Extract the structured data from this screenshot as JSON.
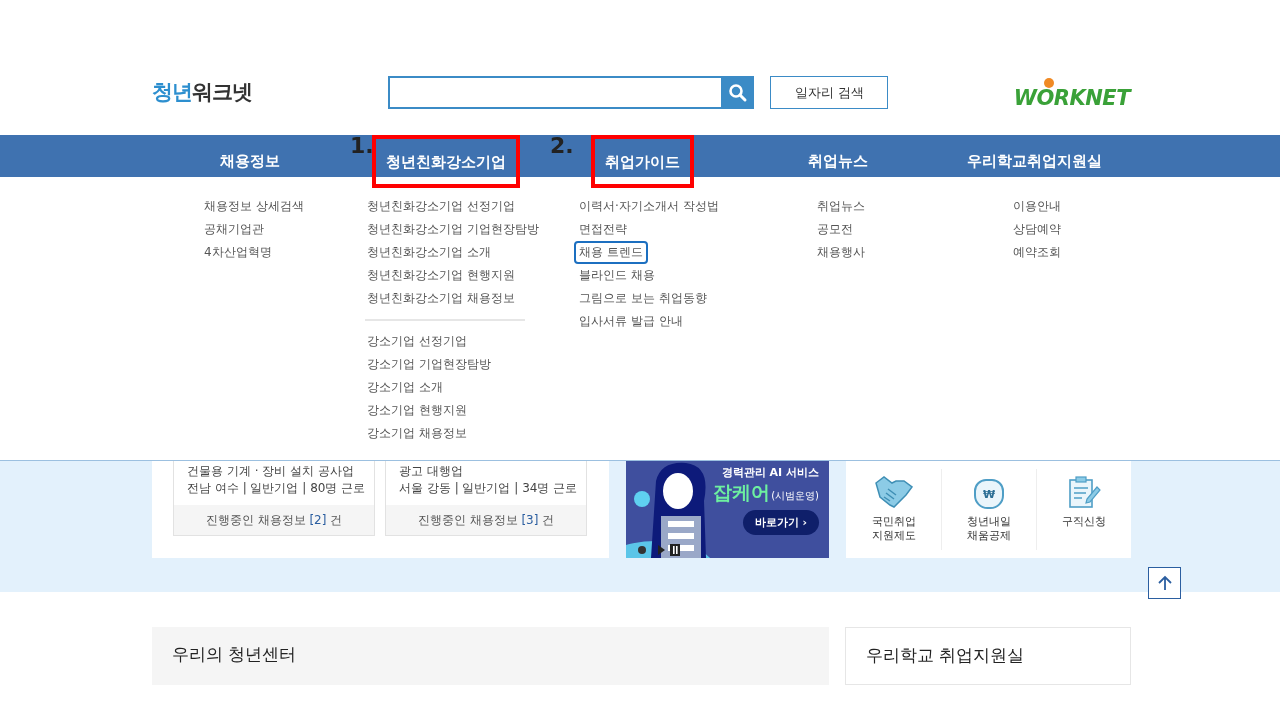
{
  "header": {
    "logo": {
      "accent": "청년",
      "rest": "워크넷"
    },
    "job_search_button": "일자리 검색",
    "partner_logo": "WORKNET"
  },
  "nav": [
    {
      "label": "채용정보",
      "highlighted": false
    },
    {
      "label": "청년친화강소기업",
      "marker": "1.",
      "highlighted": true
    },
    {
      "label": "취업가이드",
      "marker": "2.",
      "highlighted": true
    },
    {
      "label": "취업뉴스",
      "highlighted": false
    },
    {
      "label": "우리학교취업지원실",
      "highlighted": false
    }
  ],
  "dropdown": [
    {
      "groups": [
        [
          {
            "label": "채용정보 상세검색",
            "highlighted": false
          },
          {
            "label": "공채기업관",
            "highlighted": false
          },
          {
            "label": "4차산업혁명",
            "highlighted": false
          }
        ]
      ]
    },
    {
      "groups": [
        [
          {
            "label": "청년친화강소기업 선정기업",
            "highlighted": false
          },
          {
            "label": "청년친화강소기업 기업현장탐방",
            "highlighted": false
          },
          {
            "label": "청년친화강소기업 소개",
            "highlighted": false
          },
          {
            "label": "청년친화강소기업 현행지원",
            "highlighted": false
          },
          {
            "label": "청년친화강소기업 채용정보",
            "highlighted": false
          }
        ],
        [
          {
            "label": "강소기업 선정기업",
            "highlighted": false
          },
          {
            "label": "강소기업 기업현장탐방",
            "highlighted": false
          },
          {
            "label": "강소기업 소개",
            "highlighted": false
          },
          {
            "label": "강소기업 현행지원",
            "highlighted": false
          },
          {
            "label": "강소기업 채용정보",
            "highlighted": false
          }
        ]
      ]
    },
    {
      "groups": [
        [
          {
            "label": "이력서·자기소개서 작성법",
            "highlighted": false
          },
          {
            "label": "면접전략",
            "highlighted": false
          },
          {
            "label": "채용 트렌드",
            "highlighted": true
          },
          {
            "label": "블라인드 채용",
            "highlighted": false
          },
          {
            "label": "그림으로 보는 취업동향",
            "highlighted": false
          },
          {
            "label": "입사서류 발급 안내",
            "highlighted": false
          }
        ]
      ]
    },
    {
      "groups": [
        [
          {
            "label": "취업뉴스",
            "highlighted": false
          },
          {
            "label": "공모전",
            "highlighted": false
          },
          {
            "label": "채용행사",
            "highlighted": false
          }
        ]
      ]
    },
    {
      "groups": [
        [
          {
            "label": "이용안내",
            "highlighted": false
          },
          {
            "label": "상담예약",
            "highlighted": false
          },
          {
            "label": "예약조회",
            "highlighted": false
          }
        ]
      ]
    }
  ],
  "job_cards": [
    {
      "industry": "건물용 기계 · 장비 설치 공사업",
      "details": "전남 여수 | 일반기업 | 80명 근로",
      "footer_prefix": "진행중인 채용정보 ",
      "count": "[2]",
      "footer_suffix": " 건"
    },
    {
      "industry": "광고 대행업",
      "details": "서울 강동 | 일반기업 | 34명 근로",
      "footer_prefix": "진행중인 채용정보 ",
      "count": "[3]",
      "footer_suffix": " 건"
    }
  ],
  "banner": {
    "kind": "picture",
    "subtitle": "경력관리 AI 서비스",
    "title": "잡케어",
    "note": "(시범운영)",
    "button": "바로가기 ›"
  },
  "quick_links": [
    {
      "kind": "handshake",
      "lines": [
        "국민취업",
        "지원제도"
      ]
    },
    {
      "kind": "moneybag",
      "symbol": "₩",
      "lines": [
        "청년내일",
        "채움공제"
      ]
    },
    {
      "kind": "clipboard",
      "lines": [
        "구직신청"
      ]
    }
  ],
  "bottom_panels": [
    {
      "title": "우리의 청년센터"
    },
    {
      "title": "우리학교 취업지원실"
    }
  ]
}
